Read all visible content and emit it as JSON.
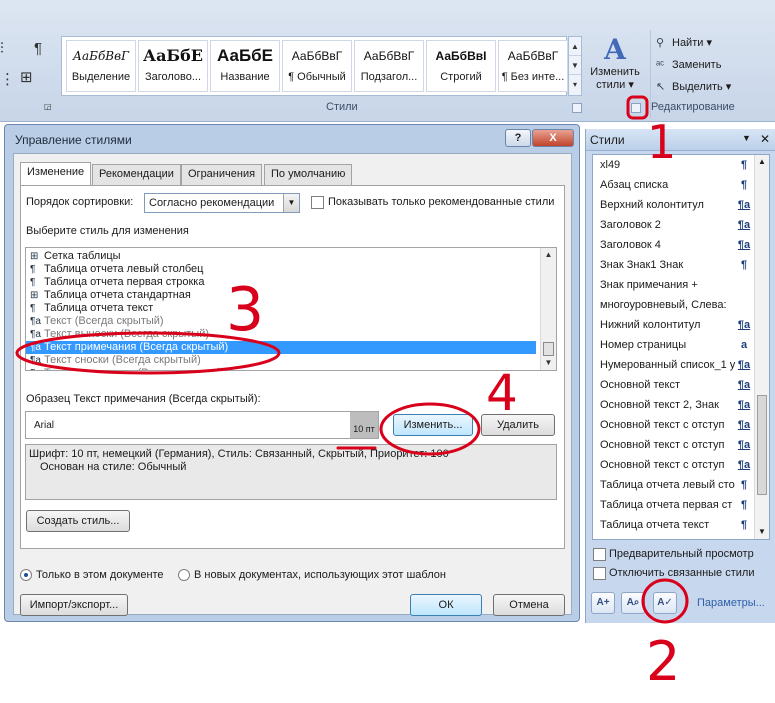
{
  "ribbon": {
    "gallery": [
      {
        "sample": "АаБбВвГ",
        "name": "Выделение"
      },
      {
        "sample": "АаБбЕ",
        "name": "Заголово..."
      },
      {
        "sample": "АаБбЕ",
        "name": "Название"
      },
      {
        "sample": "АаБбВвГ",
        "name": "¶ Обычный"
      },
      {
        "sample": "АаБбВвГ",
        "name": "Подзагол..."
      },
      {
        "sample": "АаБбВвI",
        "name": "Строгий"
      },
      {
        "sample": "АаБбВвГ",
        "name": "¶ Без инте..."
      }
    ],
    "styles_group": "Стили",
    "change_styles_line1": "Изменить",
    "change_styles_line2": "стили",
    "editing": {
      "find": "Найти",
      "replace": "Заменить",
      "select": "Выделить"
    },
    "editing_group": "Редактирование"
  },
  "dialog": {
    "title": "Управление стилями",
    "help": "?",
    "close": "X",
    "tabs": [
      "Изменение",
      "Рекомендации",
      "Ограничения",
      "По умолчанию"
    ],
    "sort_label": "Порядок сортировки:",
    "sort_value": "Согласно рекомендации",
    "show_recommended": "Показывать только рекомендованные стили",
    "choose_label": "Выберите стиль для изменения",
    "styles": [
      {
        "glyph": "⊞",
        "text": "Сетка таблицы",
        "hidden": false
      },
      {
        "glyph": "¶",
        "text": "Таблица отчета левый столбец",
        "hidden": false
      },
      {
        "glyph": "¶",
        "text": "Таблица отчета первая строкка",
        "hidden": false
      },
      {
        "glyph": "⊞",
        "text": "Таблица отчета стандартная",
        "hidden": false
      },
      {
        "glyph": "¶",
        "text": "Таблица отчета текст",
        "hidden": false
      },
      {
        "glyph": "¶a",
        "text": "Текст  (Всегда скрытый)",
        "hidden": true
      },
      {
        "glyph": "¶a",
        "text": "Текст выноски  (Всегда скрытый)",
        "hidden": true
      },
      {
        "glyph": "¶a",
        "text": "Текст примечания  (Всегда скрытый)",
        "hidden": false,
        "selected": true
      },
      {
        "glyph": "¶a",
        "text": "Текст сноски  (Всегда скрытый)",
        "hidden": true
      },
      {
        "glyph": "¶a",
        "text": "Тема примечания  (Всегда скрытый)",
        "hidden": true
      }
    ],
    "preview_label": "Образец Текст примечания  (Всегда скрытый):",
    "preview_font": "Arial",
    "preview_size": "10 пт",
    "modify_btn": "Изменить...",
    "delete_btn": "Удалить",
    "desc_line1": "Шрифт: 10 пт, немецкий (Германия), Стиль: Связанный, Скрытый, Приоритет: 100",
    "desc_line2": "Основан на стиле: Обычный",
    "new_style_btn": "Создать стиль...",
    "radio_doc": "Только в этом документе",
    "radio_template": "В новых документах, использующих этот шаблон",
    "import_btn": "Импорт/экспорт...",
    "ok_btn": "ОК",
    "cancel_btn": "Отмена"
  },
  "pane": {
    "title": "Стили",
    "items": [
      {
        "text": "xl49",
        "glyph": "¶",
        "link": false
      },
      {
        "text": "Абзац списка",
        "glyph": "¶",
        "link": false
      },
      {
        "text": "Верхний колонтитул",
        "glyph": "¶a",
        "link": true
      },
      {
        "text": "Заголовок 2",
        "glyph": "¶a",
        "link": true
      },
      {
        "text": "Заголовок 4",
        "glyph": "¶a",
        "link": true
      },
      {
        "text": "Знак Знак1 Знак",
        "glyph": "¶",
        "link": false
      },
      {
        "text": "Знак примечания + многоуровневый, Слева:",
        "glyph": "",
        "link": false,
        "two": true
      },
      {
        "text": "Нижний колонтитул",
        "glyph": "¶a",
        "link": true
      },
      {
        "text": "Номер страницы",
        "glyph": "a",
        "link": false
      },
      {
        "text": "Нумерованный список_1 у",
        "glyph": "¶a",
        "link": true
      },
      {
        "text": "Основной текст",
        "glyph": "¶a",
        "link": true
      },
      {
        "text": "Основной текст 2, Знак",
        "glyph": "¶a",
        "link": true
      },
      {
        "text": "Основной текст с отступ",
        "glyph": "¶a",
        "link": true
      },
      {
        "text": "Основной текст с отступ",
        "glyph": "¶a",
        "link": true
      },
      {
        "text": "Основной текст с отступ",
        "glyph": "¶a",
        "link": true
      },
      {
        "text": "Таблица отчета левый сто",
        "glyph": "¶",
        "link": false
      },
      {
        "text": "Таблица отчета первая ст",
        "glyph": "¶",
        "link": false
      },
      {
        "text": "Таблица отчета текст",
        "glyph": "¶",
        "link": false
      }
    ],
    "preview_chk": "Предварительный просмотр",
    "disable_linked_chk": "Отключить связанные стили",
    "options_link": "Параметры..."
  },
  "annotations": [
    "1",
    "2",
    "3",
    "4"
  ],
  "colors": {
    "selection": "#3399ff",
    "annotation": "#d9001b"
  }
}
